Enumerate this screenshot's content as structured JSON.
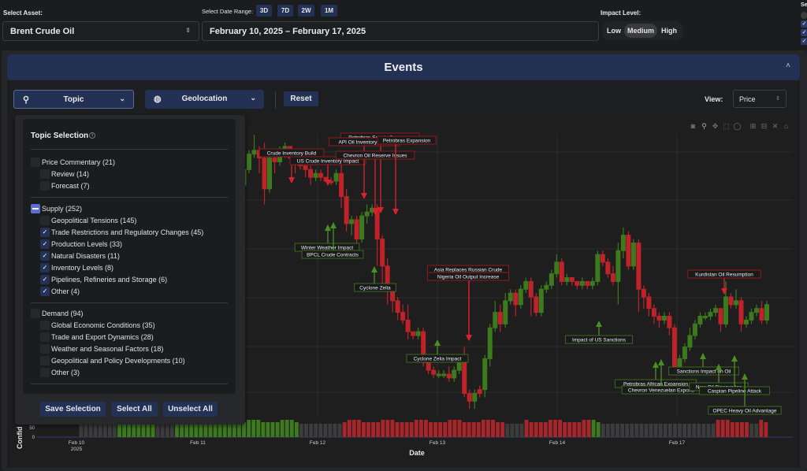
{
  "header": {
    "asset_label": "Select Asset:",
    "asset_value": "Brent Crude Oil",
    "date_range_label": "Select Date Range:",
    "range_buttons": [
      "3D",
      "7D",
      "2W",
      "1M"
    ],
    "date_range_value": "February 10, 2025 – February 17, 2025",
    "impact_label": "Impact Level:",
    "impact_options": [
      "Low",
      "Medium",
      "High"
    ],
    "impact_selected": "Medium",
    "right_edge_label": "Se"
  },
  "events": {
    "title": "Events",
    "topic_button": "Topic",
    "geo_button": "Geolocation",
    "reset_button": "Reset",
    "view_label": "View:",
    "view_value": "Price"
  },
  "topic_panel": {
    "title": "Topic Selection",
    "groups": [
      {
        "label": "Price Commentary (21)",
        "state": "unchecked",
        "children": [
          {
            "label": "Review (14)",
            "checked": false
          },
          {
            "label": "Forecast (7)",
            "checked": false
          }
        ]
      },
      {
        "label": "Supply (252)",
        "state": "indeterminate",
        "children": [
          {
            "label": "Geopolitical Tensions (145)",
            "checked": false
          },
          {
            "label": "Trade Restrictions and Regulatory Changes (45)",
            "checked": true
          },
          {
            "label": "Production Levels (33)",
            "checked": true
          },
          {
            "label": "Natural Disasters (11)",
            "checked": true
          },
          {
            "label": "Inventory Levels (8)",
            "checked": true
          },
          {
            "label": "Pipelines, Refineries and Storage (6)",
            "checked": true
          },
          {
            "label": "Other (4)",
            "checked": true
          }
        ]
      },
      {
        "label": "Demand (94)",
        "state": "unchecked",
        "children": [
          {
            "label": "Global Economic Conditions (35)",
            "checked": false
          },
          {
            "label": "Trade and Export Dynamics (28)",
            "checked": false
          },
          {
            "label": "Weather and Seasonal Factors (18)",
            "checked": false
          },
          {
            "label": "Geopolitical and Policy Developments (10)",
            "checked": false
          },
          {
            "label": "Other (3)",
            "checked": false
          }
        ]
      }
    ],
    "save_button": "Save Selection",
    "select_all_button": "Select All",
    "unselect_all_button": "Unselect All"
  },
  "modebar": [
    "camera-icon",
    "zoom-icon",
    "pan-icon",
    "box-select-icon",
    "lasso-icon",
    "zoom-in-icon",
    "zoom-out-icon",
    "autoscale-icon",
    "reset-axes-icon"
  ],
  "chart_data": {
    "type": "candlestick",
    "xlabel": "Date",
    "ylabel_confidence": "Confid",
    "x_ticks": [
      {
        "label": "Feb 10",
        "sub": "2025",
        "pos": 0
      },
      {
        "label": "Feb 11",
        "pos": 1
      },
      {
        "label": "Feb 12",
        "pos": 2
      },
      {
        "label": "Feb 13",
        "pos": 3
      },
      {
        "label": "Feb 14",
        "pos": 4
      },
      {
        "label": "Feb 17",
        "pos": 5
      }
    ],
    "confidence_ticks": [
      "0",
      "50"
    ],
    "colors": {
      "up": "#3d7a1e",
      "down": "#c0222a",
      "neutral": "#3c3c3c"
    },
    "candles": [
      [
        0.43,
        0.46,
        0.4,
        0.47,
        "u"
      ],
      [
        0.46,
        0.5,
        0.44,
        0.52,
        "u"
      ],
      [
        0.5,
        0.49,
        0.46,
        0.53,
        "d"
      ],
      [
        0.49,
        0.53,
        0.47,
        0.56,
        "u"
      ],
      [
        0.53,
        0.57,
        0.52,
        0.58,
        "u"
      ],
      [
        0.57,
        0.58,
        0.56,
        0.62,
        "u"
      ],
      [
        0.58,
        0.56,
        0.52,
        0.59,
        "d"
      ],
      [
        0.56,
        0.48,
        0.44,
        0.6,
        "d"
      ],
      [
        0.48,
        0.56,
        0.47,
        0.57,
        "u"
      ],
      [
        0.56,
        0.55,
        0.52,
        0.58,
        "d"
      ],
      [
        0.55,
        0.57,
        0.54,
        0.59,
        "u"
      ],
      [
        0.57,
        0.59,
        0.56,
        0.6,
        "u"
      ],
      [
        0.59,
        0.56,
        0.55,
        0.59,
        "d"
      ],
      [
        0.56,
        0.55,
        0.52,
        0.56,
        "d"
      ],
      [
        0.55,
        0.54,
        0.53,
        0.56,
        "d"
      ],
      [
        0.54,
        0.53,
        0.51,
        0.54,
        "d"
      ],
      [
        0.53,
        0.51,
        0.49,
        0.54,
        "d"
      ],
      [
        0.51,
        0.52,
        0.5,
        0.53,
        "u"
      ],
      [
        0.52,
        0.51,
        0.5,
        0.53,
        "d"
      ],
      [
        0.51,
        0.5,
        0.5,
        0.51,
        "d"
      ],
      [
        0.5,
        0.5,
        0.49,
        0.51,
        "d"
      ],
      [
        0.5,
        0.52,
        0.49,
        0.53,
        "u"
      ],
      [
        0.52,
        0.46,
        0.43,
        0.55,
        "d"
      ],
      [
        0.46,
        0.39,
        0.37,
        0.48,
        "d"
      ],
      [
        0.39,
        0.4,
        0.36,
        0.41,
        "u"
      ],
      [
        0.4,
        0.35,
        0.33,
        0.41,
        "d"
      ],
      [
        0.35,
        0.41,
        0.34,
        0.42,
        "u"
      ],
      [
        0.41,
        0.42,
        0.39,
        0.44,
        "u"
      ],
      [
        0.42,
        0.43,
        0.41,
        0.44,
        "u"
      ],
      [
        0.43,
        0.35,
        0.28,
        0.44,
        "d"
      ],
      [
        0.35,
        0.28,
        0.22,
        0.36,
        "d"
      ],
      [
        0.28,
        0.22,
        0.18,
        0.3,
        "d"
      ],
      [
        0.22,
        0.19,
        0.16,
        0.23,
        "d"
      ],
      [
        0.19,
        0.16,
        0.14,
        0.2,
        "d"
      ],
      [
        0.16,
        0.14,
        0.13,
        0.18,
        "d"
      ],
      [
        0.14,
        0.11,
        0.09,
        0.18,
        "d"
      ],
      [
        0.11,
        0.1,
        0.09,
        0.11,
        "d"
      ],
      [
        0.1,
        0.11,
        0.09,
        0.12,
        "u"
      ],
      [
        0.11,
        0.03,
        0.02,
        0.12,
        "d"
      ],
      [
        0.03,
        0.01,
        0.0,
        0.04,
        "d"
      ],
      [
        0.01,
        0.0,
        -0.01,
        0.02,
        "d"
      ],
      [
        0.0,
        0.0,
        -0.01,
        0.01,
        "u"
      ],
      [
        0.0,
        0.0,
        -0.01,
        0.01,
        "u"
      ],
      [
        0.0,
        -0.01,
        -0.02,
        0.02,
        "d"
      ],
      [
        -0.01,
        0.01,
        -0.02,
        0.02,
        "u"
      ],
      [
        0.01,
        0.04,
        0.0,
        0.05,
        "u"
      ],
      [
        0.04,
        -0.05,
        -0.06,
        0.07,
        "d"
      ],
      [
        -0.05,
        -0.07,
        -0.09,
        -0.04,
        "d"
      ],
      [
        -0.07,
        -0.05,
        -0.09,
        -0.04,
        "u"
      ],
      [
        -0.05,
        -0.04,
        -0.06,
        -0.03,
        "d"
      ],
      [
        -0.04,
        0.04,
        -0.06,
        0.05,
        "u"
      ],
      [
        0.04,
        0.12,
        0.02,
        0.13,
        "u"
      ],
      [
        0.12,
        0.16,
        0.11,
        0.19,
        "u"
      ],
      [
        0.16,
        0.13,
        0.11,
        0.18,
        "d"
      ],
      [
        0.13,
        0.19,
        0.12,
        0.21,
        "u"
      ],
      [
        0.19,
        0.21,
        0.18,
        0.22,
        "u"
      ],
      [
        0.21,
        0.18,
        0.15,
        0.22,
        "d"
      ],
      [
        0.18,
        0.22,
        0.17,
        0.23,
        "u"
      ],
      [
        0.22,
        0.24,
        0.21,
        0.25,
        "u"
      ],
      [
        0.24,
        0.2,
        0.15,
        0.25,
        "d"
      ],
      [
        0.2,
        0.16,
        0.15,
        0.21,
        "d"
      ],
      [
        0.16,
        0.22,
        0.15,
        0.23,
        "u"
      ],
      [
        0.22,
        0.23,
        0.21,
        0.24,
        "u"
      ],
      [
        0.23,
        0.26,
        0.22,
        0.27,
        "u"
      ],
      [
        0.26,
        0.29,
        0.25,
        0.31,
        "u"
      ],
      [
        0.29,
        0.24,
        0.23,
        0.3,
        "d"
      ],
      [
        0.24,
        0.25,
        0.23,
        0.26,
        "u"
      ],
      [
        0.25,
        0.24,
        0.23,
        0.25,
        "d"
      ],
      [
        0.24,
        0.23,
        0.22,
        0.24,
        "d"
      ],
      [
        0.23,
        0.24,
        0.22,
        0.25,
        "u"
      ],
      [
        0.24,
        0.23,
        0.22,
        0.24,
        "d"
      ],
      [
        0.23,
        0.24,
        0.22,
        0.25,
        "u"
      ],
      [
        0.24,
        0.31,
        0.23,
        0.32,
        "u"
      ],
      [
        0.31,
        0.29,
        0.28,
        0.32,
        "d"
      ],
      [
        0.29,
        0.26,
        0.25,
        0.3,
        "d"
      ],
      [
        0.26,
        0.24,
        0.23,
        0.28,
        "d"
      ],
      [
        0.24,
        0.32,
        0.18,
        0.34,
        "u"
      ],
      [
        0.32,
        0.36,
        0.3,
        0.38,
        "u"
      ],
      [
        0.36,
        0.28,
        0.27,
        0.37,
        "d"
      ],
      [
        0.28,
        0.34,
        0.27,
        0.35,
        "u"
      ],
      [
        0.34,
        0.22,
        0.16,
        0.35,
        "d"
      ],
      [
        0.22,
        0.2,
        0.17,
        0.23,
        "d"
      ],
      [
        0.2,
        0.17,
        0.15,
        0.21,
        "d"
      ],
      [
        0.17,
        0.15,
        0.13,
        0.18,
        "d"
      ],
      [
        0.15,
        0.14,
        0.12,
        0.16,
        "d"
      ],
      [
        0.14,
        0.15,
        0.13,
        0.16,
        "u"
      ],
      [
        0.15,
        0.12,
        0.1,
        0.16,
        "d"
      ],
      [
        0.12,
        0.02,
        0.01,
        0.13,
        "d"
      ],
      [
        0.02,
        0.04,
        0.01,
        0.05,
        "u"
      ],
      [
        0.04,
        0.07,
        0.03,
        0.08,
        "u"
      ],
      [
        0.07,
        0.1,
        0.06,
        0.12,
        "u"
      ],
      [
        0.1,
        0.13,
        0.09,
        0.14,
        "u"
      ],
      [
        0.13,
        0.15,
        0.12,
        0.16,
        "u"
      ],
      [
        0.15,
        0.15,
        0.14,
        0.16,
        "u"
      ],
      [
        0.15,
        0.16,
        0.14,
        0.17,
        "u"
      ],
      [
        0.16,
        0.17,
        0.15,
        0.18,
        "u"
      ],
      [
        0.17,
        0.13,
        0.11,
        0.17,
        "d"
      ],
      [
        0.13,
        0.2,
        0.12,
        0.24,
        "u"
      ],
      [
        0.2,
        0.18,
        0.17,
        0.21,
        "d"
      ],
      [
        0.18,
        0.19,
        0.17,
        0.22,
        "u"
      ],
      [
        0.19,
        0.13,
        0.11,
        0.2,
        "d"
      ],
      [
        0.13,
        0.14,
        0.12,
        0.15,
        "u"
      ],
      [
        0.14,
        0.16,
        0.13,
        0.17,
        "u"
      ],
      [
        0.16,
        0.17,
        0.15,
        0.18,
        "u"
      ],
      [
        0.17,
        0.14,
        0.13,
        0.19,
        "d"
      ],
      [
        0.14,
        0.18,
        0.13,
        0.19,
        "u"
      ]
    ],
    "confidence_bars": "nnnnnnnnggggggggnnnnggggggggggggggggggggggggggnnnnnnnnnrrrrrrrrrrrrrrrrrrrrrrrrrrrrrrrrrrnnnnrrrrrrrrrrrrrrggnnnnnnnnnnnnnnnnnnnnnnnnrrrrrrrnnrr",
    "annotations": [
      {
        "text": "Crude Inventory Build",
        "dir": "down",
        "candle": 14,
        "tone": "red"
      },
      {
        "text": "US Crude Inventory Impact",
        "dir": "down",
        "candle": 21,
        "tone": "red"
      },
      {
        "text": "Petrobras Supply Contracts",
        "dir": "down",
        "candle": 30,
        "tone": "red"
      },
      {
        "text": "API Oil Inventory Build",
        "dir": "down",
        "candle": 28,
        "tone": "red"
      },
      {
        "text": "Chevron Oil Reserve Issues",
        "dir": "down",
        "candle": 29,
        "tone": "red"
      },
      {
        "text": "Petrobras Expansion",
        "dir": "down",
        "candle": 32,
        "tone": "red"
      },
      {
        "text": "Winter Weather Impact",
        "dir": "up",
        "candle": 21,
        "tone": "green"
      },
      {
        "text": "BPCL Crude Contracts",
        "dir": "up",
        "candle": 22,
        "tone": "green"
      },
      {
        "text": "Cyclone Zelia",
        "dir": "up",
        "candle": 28,
        "tone": "green"
      },
      {
        "text": "Asia Replaces Russian Crude",
        "dir": "down",
        "candle": 40,
        "tone": "red"
      },
      {
        "text": "Nigeria Oil Output Increase",
        "dir": "down",
        "candle": 40,
        "tone": "red"
      },
      {
        "text": "Cyclone Zelia Impact",
        "dir": "up",
        "candle": 36,
        "tone": "green"
      },
      {
        "text": "Impact of US Sanctions",
        "dir": "up",
        "candle": 63,
        "tone": "green"
      },
      {
        "text": "Kurdistan Oil Resumption",
        "dir": "down",
        "candle": 95,
        "tone": "red"
      },
      {
        "text": "Petrobras African Expansion",
        "dir": "up",
        "candle": 80,
        "tone": "green"
      },
      {
        "text": "Chevron Venezuelan Exports",
        "dir": "up",
        "candle": 81,
        "tone": "green"
      },
      {
        "text": "Sanctions Impact on Oil",
        "dir": "up",
        "candle": 90,
        "tone": "green"
      },
      {
        "text": "New Oil Discoveries",
        "dir": "up",
        "candle": 93,
        "tone": "green"
      },
      {
        "text": "Caspian Pipeline Attack",
        "dir": "up",
        "candle": 96,
        "tone": "green"
      },
      {
        "text": "OPEC Heavy Oil Advantage",
        "dir": "up",
        "candle": 98,
        "tone": "green"
      }
    ]
  }
}
